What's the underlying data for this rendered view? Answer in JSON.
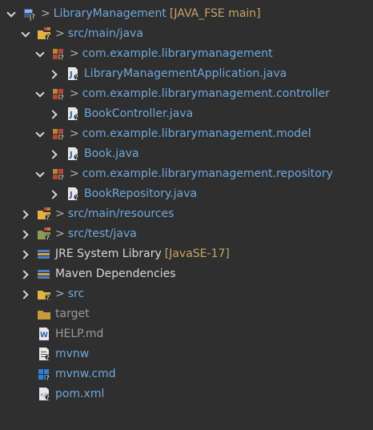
{
  "project": {
    "name": "LibraryManagement",
    "decoration": "[JAVA_FSE main]"
  },
  "src_main_java": {
    "label": "src/main/java"
  },
  "packages": [
    {
      "name": "com.example.librarymanagement",
      "files": [
        "LibraryManagementApplication.java"
      ]
    },
    {
      "name": "com.example.librarymanagement.controller",
      "files": [
        "BookController.java"
      ]
    },
    {
      "name": "com.example.librarymanagement.model",
      "files": [
        "Book.java"
      ]
    },
    {
      "name": "com.example.librarymanagement.repository",
      "files": [
        "BookRepository.java"
      ]
    }
  ],
  "src_main_resources": {
    "label": "src/main/resources"
  },
  "src_test_java": {
    "label": "src/test/java"
  },
  "jre": {
    "label": "JRE System Library",
    "decoration": "[JavaSE-17]"
  },
  "maven": {
    "label": "Maven Dependencies"
  },
  "src": {
    "label": "src"
  },
  "target": {
    "label": "target"
  },
  "help": {
    "label": "HELP.md"
  },
  "mvnw": {
    "label": "mvnw"
  },
  "mvnw_cmd": {
    "label": "mvnw.cmd"
  },
  "pom": {
    "label": "pom.xml"
  },
  "prefix_symbol": ">"
}
